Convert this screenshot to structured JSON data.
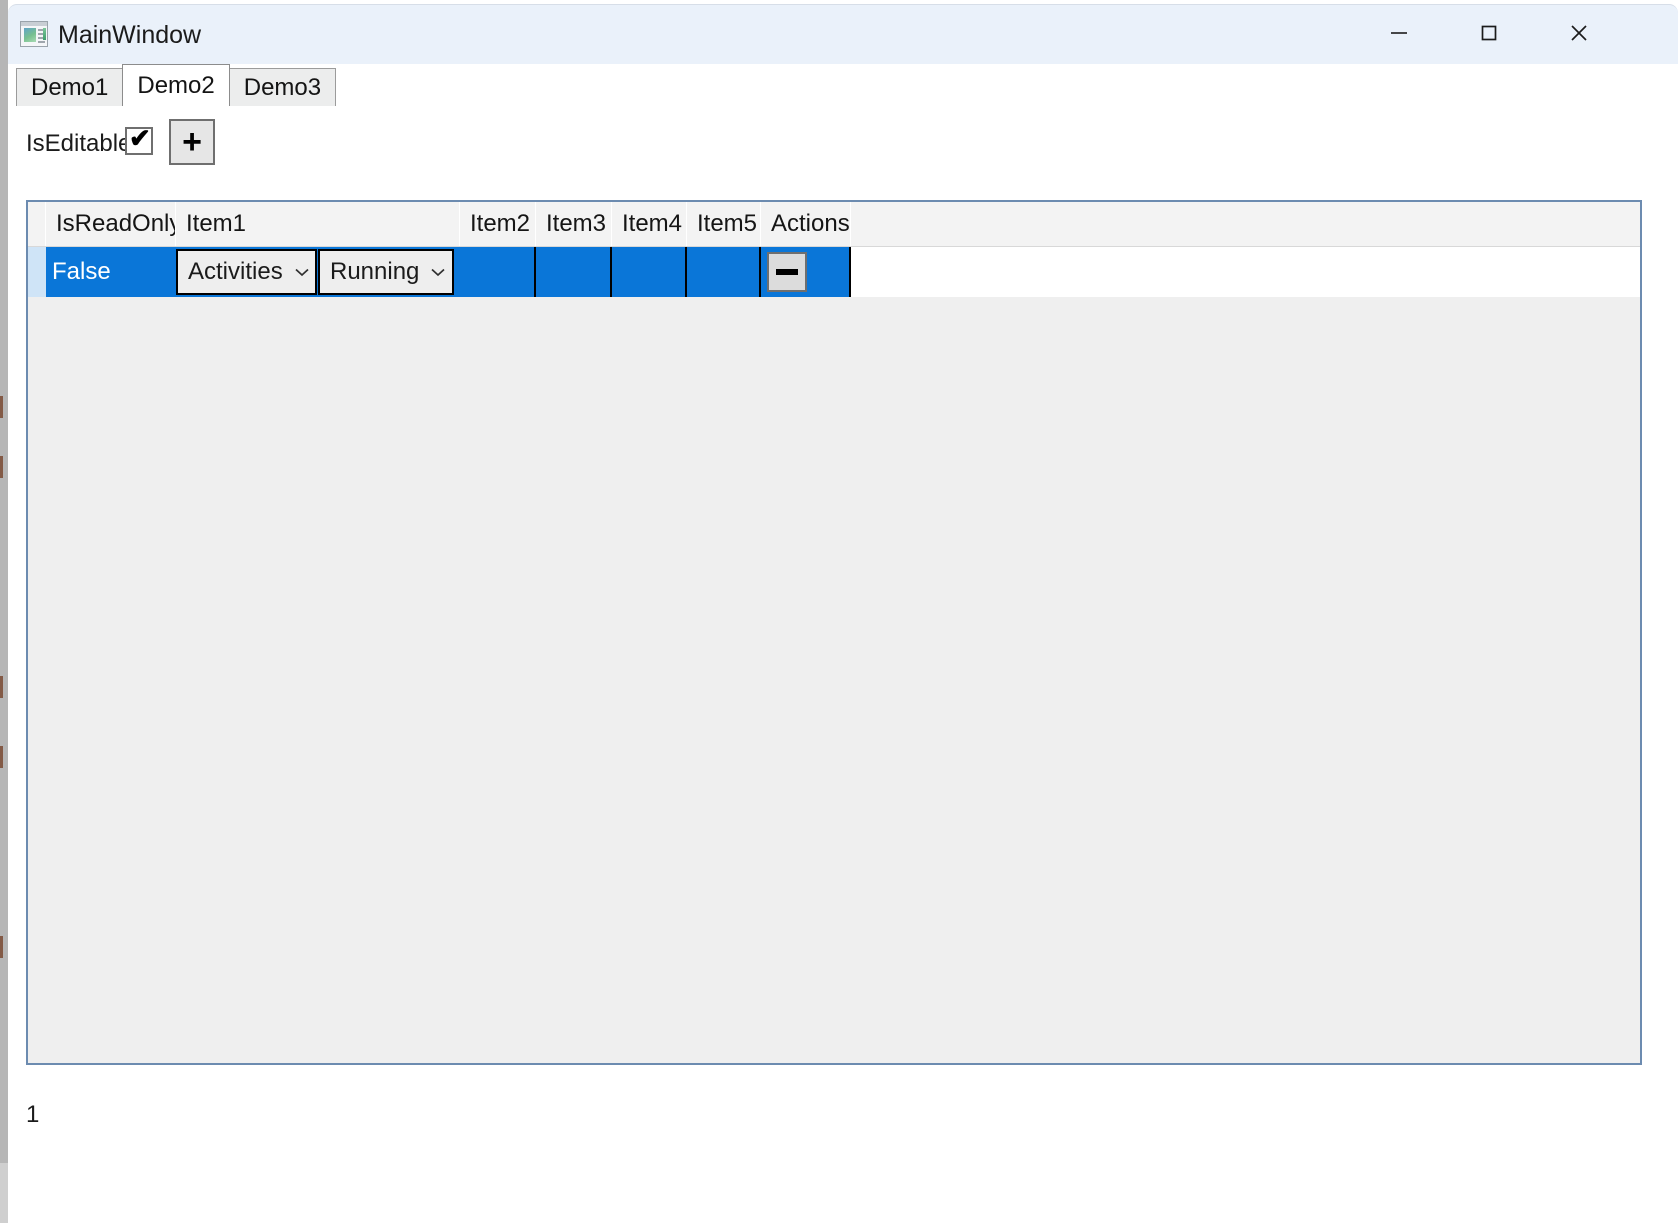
{
  "window": {
    "title": "MainWindow",
    "icon": "app-window-icon",
    "controls": {
      "minimize": "minimize-icon",
      "maximize": "maximize-icon",
      "close": "close-icon"
    },
    "titlebar_color": "#eaf1fa"
  },
  "tabs": [
    {
      "label": "Demo1",
      "active": false
    },
    {
      "label": "Demo2",
      "active": true
    },
    {
      "label": "Demo3",
      "active": false
    }
  ],
  "toolbar": {
    "is_editable_label": "IsEditable",
    "is_editable_checked": true,
    "check_glyph": "✔",
    "add_button_label": "+",
    "add_button_icon": "plus-icon"
  },
  "grid": {
    "accent_color": "#0a76d8",
    "border_color": "#6c8bb0",
    "columns": [
      "IsReadOnly",
      "Item1",
      "Item2",
      "Item3",
      "Item4",
      "Item5",
      "Actions"
    ],
    "rows": [
      {
        "is_read_only": "False",
        "item1": {
          "combo_a": {
            "value": "Activities"
          },
          "combo_b": {
            "value": "Running"
          }
        },
        "item2": "",
        "item3": "",
        "item4": "",
        "item5": "",
        "actions": {
          "remove_label": "−",
          "remove_icon": "minus-icon"
        },
        "selected": true
      }
    ]
  },
  "status": {
    "count": "1"
  }
}
